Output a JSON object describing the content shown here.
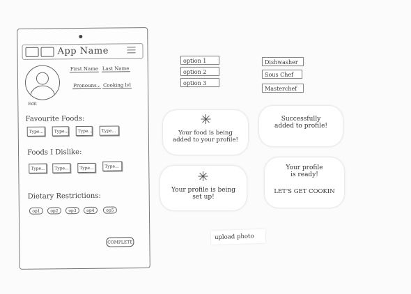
{
  "phone": {
    "app_name": "App Name",
    "first_name": "First Name",
    "last_name": "Last Name",
    "pronouns": "Pronouns",
    "cooking_lv": "Cooking lvl",
    "edit": "Edit",
    "favourite_foods_label": "Favourite Foods:",
    "favourite_foods": [
      "Type...",
      "Type...",
      "Type...",
      "Type..."
    ],
    "dislikes_label": "Foods I Dislike:",
    "dislikes": [
      "Type...",
      "Type...",
      "Type...",
      "Type..."
    ],
    "dietary_label": "Dietary Restrictions:",
    "dietary_options": [
      "op1",
      "op2",
      "op3",
      "op4",
      "op5"
    ],
    "complete_label": "COMPLETE"
  },
  "options_list": [
    "option 1",
    "option 2",
    "option 3"
  ],
  "cooking_levels": [
    "Dishwasher",
    "Sous Chef",
    "Masterchef"
  ],
  "cards": {
    "food_adding": "Your food is being added to your profile!",
    "food_added": "Successfully added to profile!",
    "profile_setup": "Your profile is being set up!",
    "profile_ready": "Your profile is ready!",
    "profile_ready_cta": "LET'S GET COOKIN"
  },
  "upload_photo": "upload photo"
}
